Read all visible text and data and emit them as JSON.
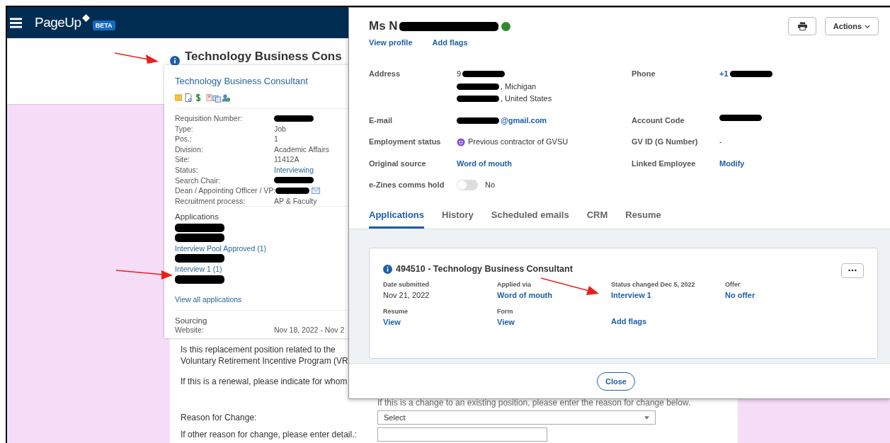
{
  "app_header": {
    "logo": "PageUp",
    "badge": "BETA"
  },
  "page": {
    "title": "Technology Business Cons",
    "form": [
      {
        "kind": "question",
        "label": "Is this replacement position related to the Voluntary Retirement Incentive Program (VR"
      },
      {
        "kind": "question",
        "label": "If this is a renewal, please indicate for whom"
      },
      {
        "kind": "hint",
        "text": "If this is a change to an existing position, please enter the reason for change below."
      },
      {
        "kind": "select",
        "label": "Reason for Change:",
        "value": "Select"
      },
      {
        "kind": "input",
        "label": "If other reason for change, please enter detail.:"
      }
    ]
  },
  "requisition_popup": {
    "title": "Technology Business Consultant",
    "fields": [
      {
        "label": "Requisition Number:",
        "kind": "redacted"
      },
      {
        "label": "Type:",
        "kind": "text",
        "value": "Job"
      },
      {
        "label": "Pos.:",
        "kind": "text",
        "value": "1"
      },
      {
        "label": "Division:",
        "kind": "text",
        "value": "Academic Affairs"
      },
      {
        "label": "Site:",
        "kind": "text",
        "value": "11412A"
      },
      {
        "label": "Status:",
        "kind": "link",
        "value": "Interviewing"
      },
      {
        "label": "Search Chair:",
        "kind": "redacted"
      },
      {
        "label": "Dean / Appointing Officer / VP:",
        "kind": "redacted_mail"
      },
      {
        "label": "Recruitment process:",
        "kind": "text",
        "value": "AP & Faculty"
      }
    ],
    "applications_heading": "Applications",
    "applications": [
      {
        "kind": "redacted"
      },
      {
        "kind": "redacted"
      },
      {
        "kind": "status",
        "label": "Interview Pool Approved",
        "count": "(1)"
      },
      {
        "kind": "redacted"
      },
      {
        "kind": "status",
        "label": "Interview 1",
        "count": "(1)"
      },
      {
        "kind": "redacted"
      }
    ],
    "view_all": "View all applications",
    "sourcing_heading": "Sourcing",
    "website_label": "Website:",
    "website_value": "Nov 18, 2022 - Nov 2"
  },
  "candidate_modal": {
    "name": "Ms N",
    "online": true,
    "links": [
      "View profile",
      "Add flags"
    ],
    "actions": "Actions",
    "details": [
      {
        "label": "Address",
        "kind": "text",
        "lines": [
          [
            {
              "kind": "text",
              "text": "9"
            },
            {
              "kind": "redaction"
            }
          ],
          [
            {
              "kind": "redaction"
            },
            {
              "kind": "text",
              "text": ", Michigan"
            }
          ],
          [
            {
              "kind": "redaction"
            },
            {
              "kind": "text",
              "text": ", United States"
            }
          ]
        ]
      },
      {
        "label": "Phone",
        "kind": "link",
        "lines": [
          [
            {
              "kind": "text",
              "text": "+1"
            },
            {
              "kind": "redaction"
            }
          ]
        ]
      },
      {
        "label": "E-mail",
        "kind": "link",
        "lines": [
          [
            {
              "kind": "redaction"
            },
            {
              "kind": "text",
              "text": "@gmail.com"
            }
          ]
        ]
      },
      {
        "label": "Account Code",
        "kind": "text",
        "lines": [
          [
            {
              "kind": "redaction"
            }
          ]
        ]
      },
      {
        "label": "Employment status",
        "kind": "status",
        "lines": [
          [
            {
              "kind": "text",
              "text": "Previous contractor of GVSU"
            }
          ]
        ]
      },
      {
        "label": "GV ID (G Number)",
        "kind": "text",
        "lines": [
          [
            {
              "kind": "text",
              "text": "-"
            }
          ]
        ]
      },
      {
        "label": "Original source",
        "kind": "link",
        "lines": [
          [
            {
              "kind": "text",
              "text": "Word of mouth"
            }
          ]
        ]
      },
      {
        "label": "Linked Employee",
        "kind": "link",
        "lines": [
          [
            {
              "kind": "text",
              "text": "Modify"
            }
          ]
        ]
      },
      {
        "label": "e-Zines comms hold",
        "kind": "toggle",
        "on": false,
        "lines": [
          [
            {
              "kind": "text",
              "text": "No"
            }
          ]
        ]
      }
    ],
    "tabs": [
      {
        "label": "Applications",
        "selected": true
      },
      {
        "label": "History",
        "selected": false
      },
      {
        "label": "Scheduled emails",
        "selected": false
      },
      {
        "label": "CRM",
        "selected": false
      },
      {
        "label": "Resume",
        "selected": false
      }
    ],
    "application": {
      "title": "494510 - Technology Business Consultant",
      "fields": [
        {
          "label": "Date submitted",
          "kind": "text",
          "value": "Nov 21, 2022"
        },
        {
          "label": "Applied via",
          "kind": "link",
          "value": "Word of mouth"
        },
        {
          "label": "Status changed Dec 5, 2022",
          "kind": "link",
          "value": "Interview 1"
        },
        {
          "label": "Offer",
          "kind": "link",
          "value": "No offer"
        },
        {
          "label": "Resume",
          "kind": "link",
          "value": "View"
        },
        {
          "label": "Form",
          "kind": "link",
          "value": "View"
        },
        {
          "kind": "link",
          "value": "Add flags"
        }
      ]
    },
    "close": "Close"
  }
}
